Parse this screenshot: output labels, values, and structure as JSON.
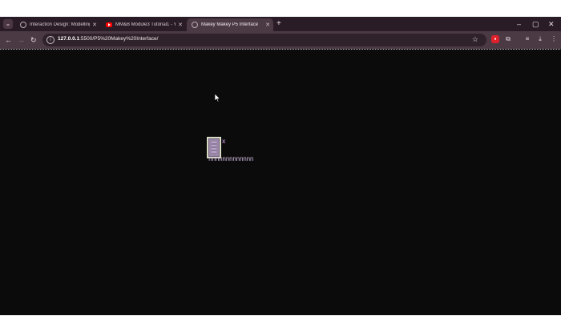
{
  "browser": {
    "tabs": [
      {
        "title": "Interaction Design: Modelling",
        "favicon": "globe-icon",
        "active": false
      },
      {
        "title": "MM&B Module3 Tutorial1 - You",
        "favicon": "youtube-icon",
        "active": false
      },
      {
        "title": "Makey Makey P5 Interface",
        "favicon": "globe-icon",
        "active": true
      }
    ],
    "new_tab_symbol": "+",
    "window_controls": {
      "minimize": "–",
      "maximize": "▢",
      "close": "✕"
    },
    "address": {
      "host": "127.0.0.1",
      "path": ":5500/P5%20Makey%20Interface/"
    }
  },
  "page": {
    "background": "#0c0b0c",
    "key_label": "x",
    "output_text": "nnnnnnnnnnnnn"
  },
  "colors": {
    "tabstrip": "#2a1c26",
    "toolbar": "#4b3a44",
    "sprite_fill": "#9b87a8",
    "accent": "#a77fb3"
  }
}
